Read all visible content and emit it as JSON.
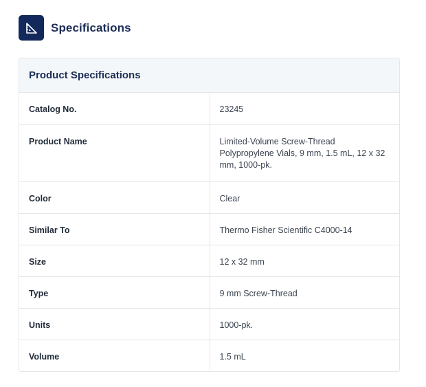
{
  "section": {
    "title": "Specifications"
  },
  "card": {
    "title": "Product Specifications"
  },
  "specs": [
    {
      "label": "Catalog No.",
      "value": "23245"
    },
    {
      "label": "Product Name",
      "value": "Limited-Volume Screw-Thread Polypropylene Vials, 9 mm, 1.5 mL, 12 x 32 mm, 1000-pk."
    },
    {
      "label": "Color",
      "value": "Clear"
    },
    {
      "label": "Similar To",
      "value": "Thermo Fisher Scientific C4000-14"
    },
    {
      "label": "Size",
      "value": "12 x 32 mm"
    },
    {
      "label": "Type",
      "value": "9 mm Screw-Thread"
    },
    {
      "label": "Units",
      "value": "1000-pk."
    },
    {
      "label": "Volume",
      "value": "1.5 mL"
    }
  ],
  "icons": {
    "header_icon": "set-square-ruler-icon"
  },
  "colors": {
    "accent": "#13295b",
    "title_text": "#1c2d56",
    "card_header_bg": "#f4f7f9",
    "border": "#e3e6ea"
  }
}
